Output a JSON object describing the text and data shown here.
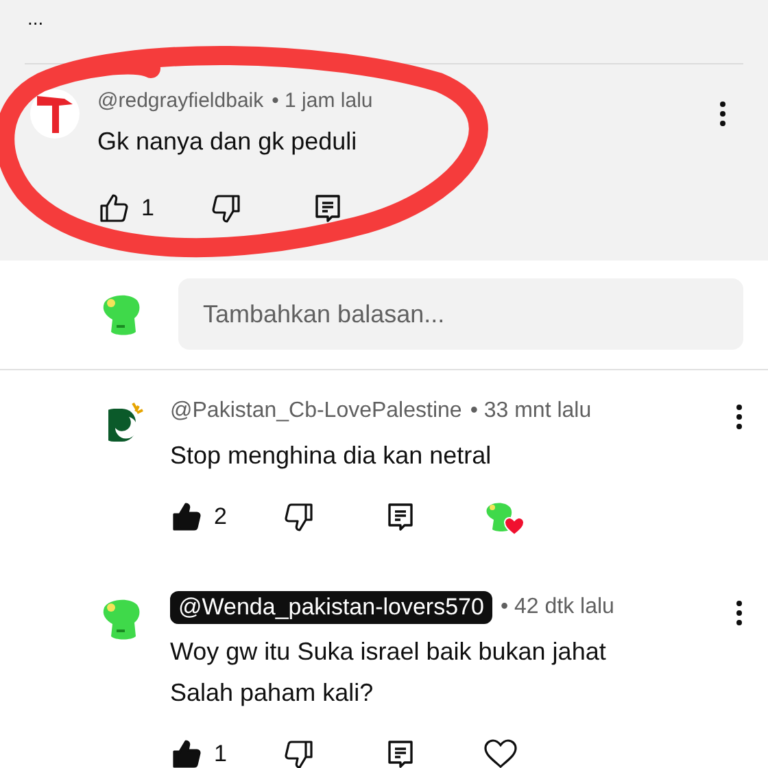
{
  "top_comment": {
    "more": "...",
    "author": "@redgrayfieldbaik",
    "time": "• 1 jam lalu",
    "text": "Gk nanya dan gk peduli",
    "likes": "1",
    "liked": false,
    "highlighted": true
  },
  "reply_field": {
    "placeholder": "Tambahkan balasan..."
  },
  "replies": [
    {
      "author": "@Pakistan_Cb-LovePalestine",
      "owner": false,
      "avatar": {
        "kind": "flag"
      },
      "time": "• 33 mnt lalu",
      "lines": [
        "Stop menghina dia kan netral"
      ],
      "likes": "2",
      "liked": true,
      "heart": {
        "kind": "creator"
      }
    },
    {
      "author": "@Wenda_pakistan-lovers570",
      "owner": true,
      "avatar": {
        "kind": "green"
      },
      "time": "• 42 dtk lalu",
      "lines": [
        "Woy gw itu Suka israel baik bukan jahat",
        "Salah paham kali?"
      ],
      "likes": "1",
      "liked": true,
      "heart": {
        "kind": "empty"
      }
    }
  ]
}
